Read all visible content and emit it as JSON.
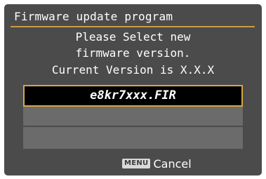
{
  "header": {
    "title": "Firmware update program"
  },
  "message": {
    "line1": "Please Select new",
    "line2": "firmware version.",
    "line3": "Current Version is X.X.X"
  },
  "firmware_list": {
    "items": [
      {
        "label": "e8kr7xxx.FIR",
        "selected": true
      },
      {
        "label": "",
        "selected": false
      },
      {
        "label": "",
        "selected": false
      }
    ]
  },
  "footer": {
    "button_badge": "MENU",
    "action_label": "Cancel"
  },
  "colors": {
    "screen_bg": "#4b4b4b",
    "accent": "#d7a649",
    "list_bg": "#6b6b6b"
  }
}
